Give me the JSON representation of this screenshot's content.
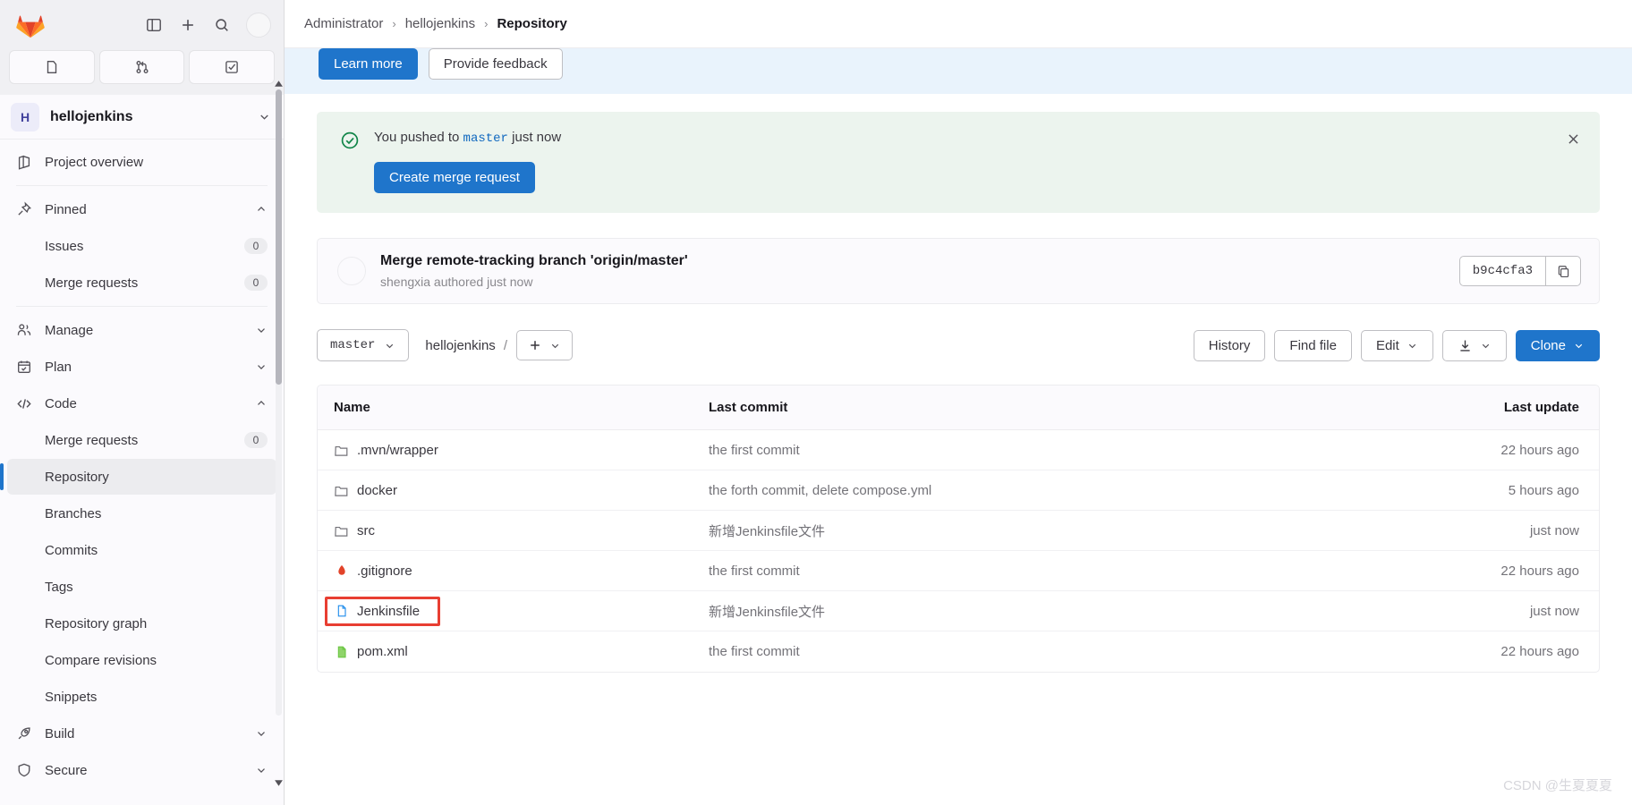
{
  "sidebar": {
    "top_icons": [
      {
        "name": "sidebar-toggle-icon",
        "label": "Toggle sidebar"
      },
      {
        "name": "new-item-icon",
        "label": "Create new"
      },
      {
        "name": "search-icon",
        "label": "Search"
      }
    ],
    "avatar_label": "",
    "quick_links": [
      {
        "name": "issues-quick-icon",
        "label": "Issues"
      },
      {
        "name": "merge-requests-quick-icon",
        "label": "Merge requests"
      },
      {
        "name": "todos-quick-icon",
        "label": "To-Do list"
      }
    ],
    "project": {
      "initial": "H",
      "name": "hellojenkins"
    },
    "items": [
      {
        "label": "Project overview",
        "icon": "project-overview-icon",
        "type": "top"
      },
      {
        "label": "Pinned",
        "icon": "pin-icon",
        "type": "group",
        "expanded": true
      },
      {
        "label": "Issues",
        "type": "sub",
        "count": "0"
      },
      {
        "label": "Merge requests",
        "type": "sub",
        "count": "0"
      },
      {
        "label": "Manage",
        "icon": "users-icon",
        "type": "group",
        "expanded": false
      },
      {
        "label": "Plan",
        "icon": "calendar-icon",
        "type": "group",
        "expanded": false
      },
      {
        "label": "Code",
        "icon": "code-icon",
        "type": "group",
        "expanded": true
      },
      {
        "label": "Merge requests",
        "type": "sub",
        "count": "0"
      },
      {
        "label": "Repository",
        "type": "sub",
        "active": true
      },
      {
        "label": "Branches",
        "type": "sub"
      },
      {
        "label": "Commits",
        "type": "sub"
      },
      {
        "label": "Tags",
        "type": "sub"
      },
      {
        "label": "Repository graph",
        "type": "sub"
      },
      {
        "label": "Compare revisions",
        "type": "sub"
      },
      {
        "label": "Snippets",
        "type": "sub"
      },
      {
        "label": "Build",
        "icon": "rocket-icon",
        "type": "group",
        "expanded": false
      },
      {
        "label": "Secure",
        "icon": "shield-icon",
        "type": "group",
        "expanded": false
      }
    ]
  },
  "breadcrumb": {
    "items": [
      "Administrator",
      "hellojenkins",
      "Repository"
    ],
    "separator": "›"
  },
  "promo": {
    "learn_more": "Learn more",
    "provide_feedback": "Provide feedback"
  },
  "push_alert": {
    "prefix": "You pushed to",
    "branch": "master",
    "suffix": "just now",
    "cta": "Create merge request",
    "close_label": "×"
  },
  "last_commit": {
    "title": "Merge remote-tracking branch 'origin/master'",
    "author": "shengxia",
    "meta": "shengxia authored just now",
    "sha": "b9c4cfa3"
  },
  "toolbar": {
    "branch": "master",
    "path_root": "hellojenkins",
    "path_sep": "/",
    "add_label": "+",
    "history": "History",
    "find_file": "Find file",
    "edit": "Edit",
    "download": "download-icon",
    "clone": "Clone"
  },
  "file_table": {
    "columns": [
      "Name",
      "Last commit",
      "Last update"
    ],
    "rows": [
      {
        "name": ".mvn/wrapper",
        "icon": "folder-icon",
        "commit": "the first commit",
        "update": "22 hours ago",
        "highlight": false
      },
      {
        "name": "docker",
        "icon": "folder-icon",
        "commit": "the forth commit, delete compose.yml",
        "update": "5 hours ago",
        "highlight": false
      },
      {
        "name": "src",
        "icon": "folder-icon",
        "commit": "新增Jenkinsfile文件",
        "update": "just now",
        "highlight": false
      },
      {
        "name": ".gitignore",
        "icon": "git-file-icon",
        "commit": "the first commit",
        "update": "22 hours ago",
        "highlight": false
      },
      {
        "name": "Jenkinsfile",
        "icon": "text-file-icon",
        "commit": "新增Jenkinsfile文件",
        "update": "just now",
        "highlight": true
      },
      {
        "name": "pom.xml",
        "icon": "xml-file-icon",
        "commit": "the first commit",
        "update": "22 hours ago",
        "highlight": false
      }
    ]
  },
  "watermark": "CSDN @生夏夏夏",
  "colors": {
    "accent": "#1f75cb",
    "success_bg": "#ecf4ee",
    "success_fg": "#108548",
    "promo_bg": "#e9f3fc",
    "highlight": "#e83e32"
  }
}
